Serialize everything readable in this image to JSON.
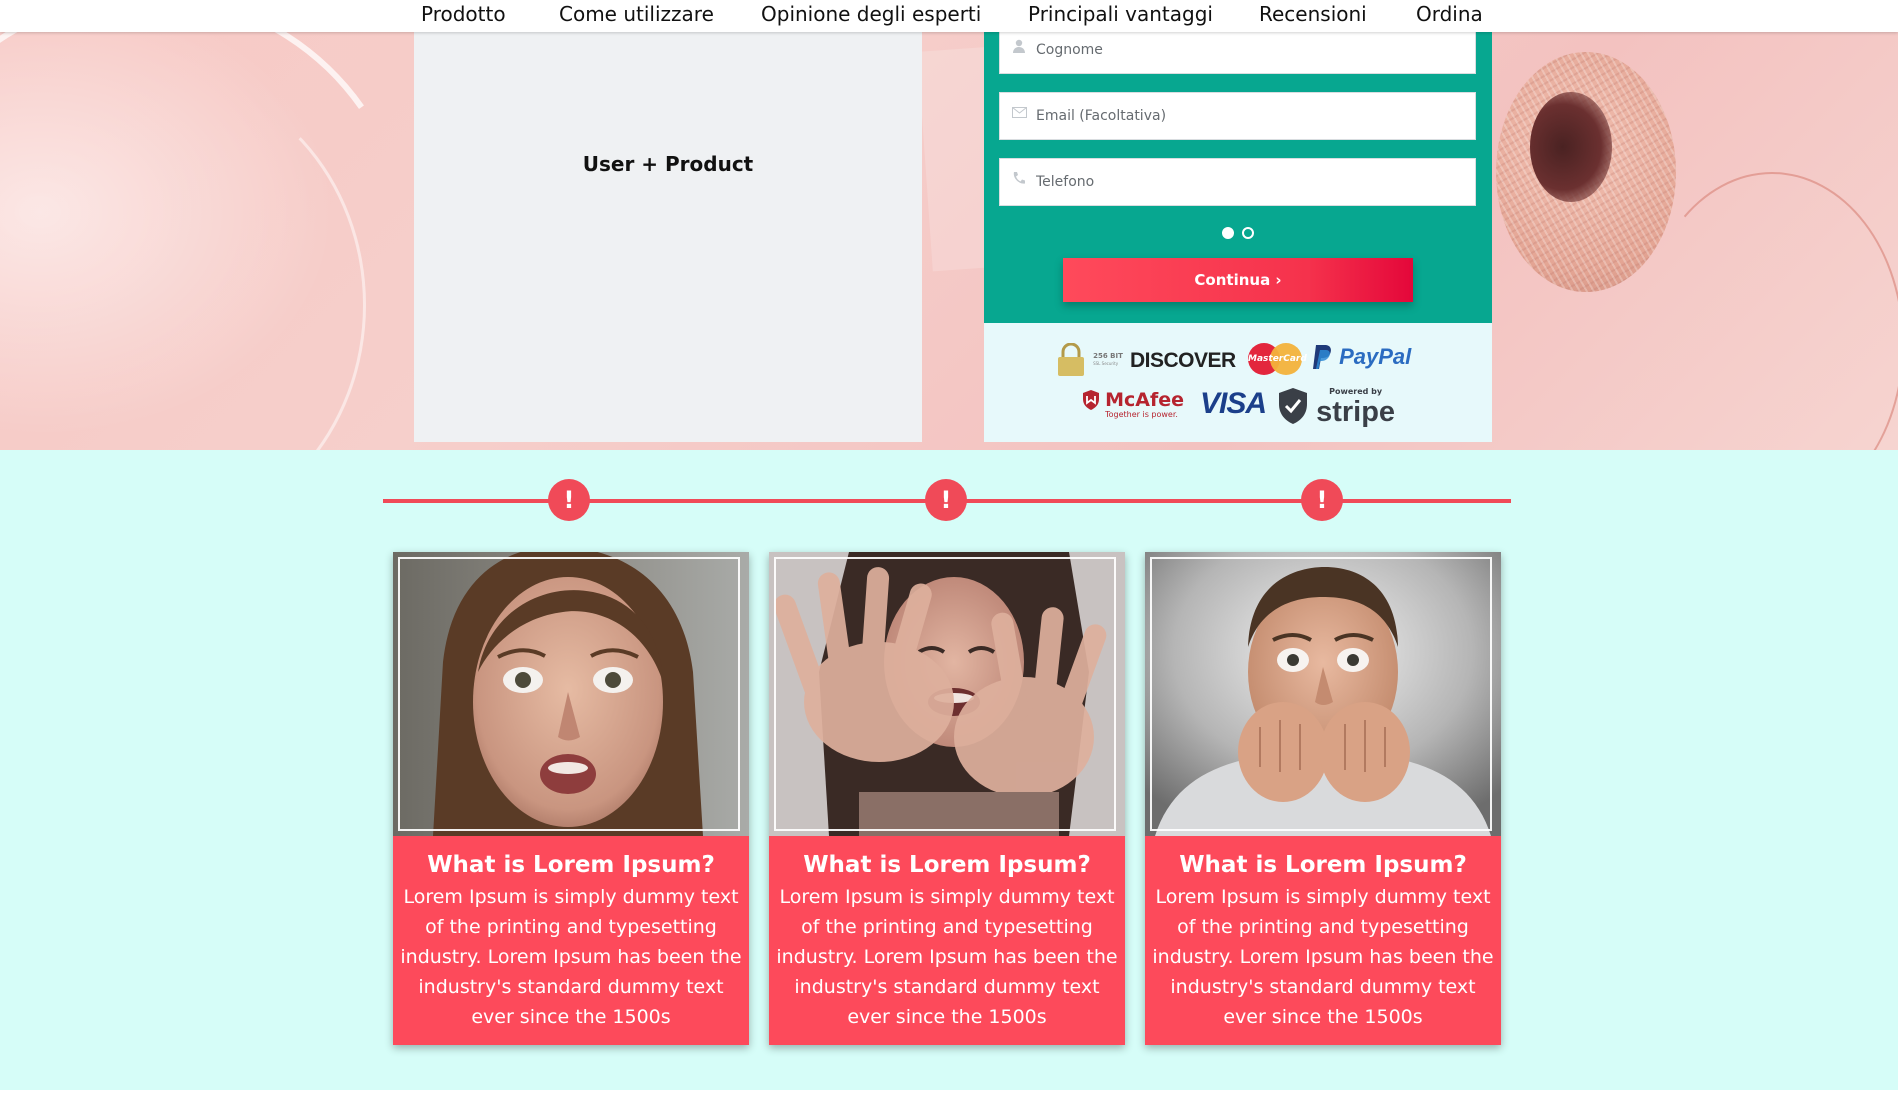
{
  "nav": {
    "items": [
      "Prodotto",
      "Come utilizzare",
      "Opinione degli esperti",
      "Principali vantaggi",
      "Recensioni",
      "Ordina"
    ]
  },
  "product": {
    "label": "User + Product"
  },
  "form": {
    "fields": [
      {
        "placeholder": "Cognome",
        "icon": "user-icon"
      },
      {
        "placeholder": "Email (Facoltativa)",
        "icon": "envelope-icon"
      },
      {
        "placeholder": "Telefono",
        "icon": "phone-icon"
      }
    ],
    "continue_label": "Continua ›",
    "colors": {
      "panel": "#07a790",
      "button": "#f5324c"
    }
  },
  "badges": {
    "ssl": {
      "main": "256 BIT",
      "sub": "SSL Security"
    },
    "discover": "DISCOVER",
    "mastercard": "MasterCard",
    "paypal": "PayPal",
    "mcafee": {
      "name": "McAfee",
      "tagline": "Together is power."
    },
    "visa": "VISA",
    "stripe": {
      "powered": "Powered by",
      "name": "stripe"
    }
  },
  "timeline": {
    "marker": "!"
  },
  "cards": [
    {
      "title": "What is Lorem Ipsum?",
      "text": "Lorem Ipsum is simply dummy text of the printing and typesetting industry. Lorem Ipsum has been the industry's standard dummy text ever since the 1500s"
    },
    {
      "title": "What is Lorem Ipsum?",
      "text": "Lorem Ipsum is simply dummy text of the printing and typesetting industry. Lorem Ipsum has been the industry's standard dummy text ever since the 1500s"
    },
    {
      "title": "What is Lorem Ipsum?",
      "text": "Lorem Ipsum is simply dummy text of the printing and typesetting industry. Lorem Ipsum has been the industry's standard dummy text ever since the 1500s"
    }
  ]
}
